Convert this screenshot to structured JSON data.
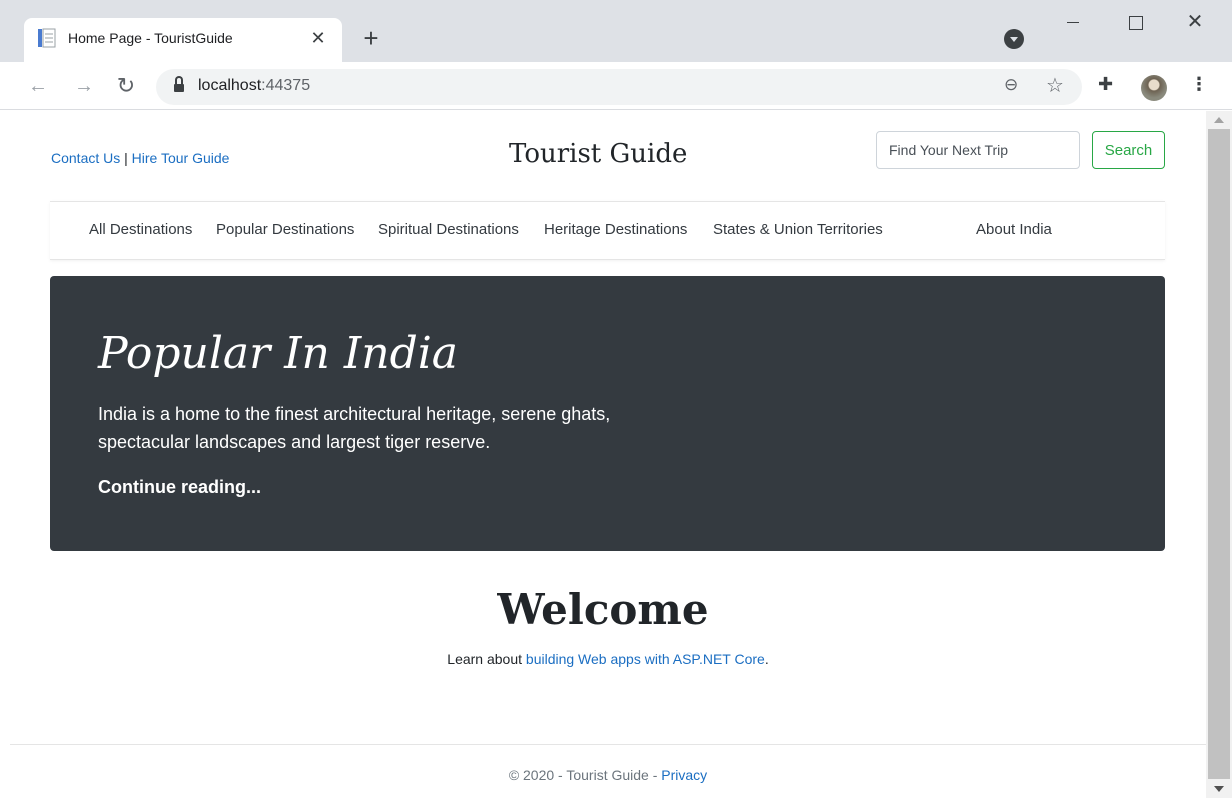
{
  "browser": {
    "tab_title": "Home Page - TouristGuide",
    "tab_close": "✕",
    "new_tab": "+",
    "url_host": "localhost",
    "url_port": ":44375",
    "window_close": "✕"
  },
  "header": {
    "contact_link": "Contact Us",
    "separator": " | ",
    "hire_link": "Hire Tour Guide",
    "site_title": "Tourist Guide",
    "search_placeholder": "Find Your Next Trip",
    "search_button": "Search"
  },
  "nav": {
    "items": [
      "All Destinations",
      "Popular Destinations",
      "Spiritual Destinations",
      "Heritage Destinations",
      "States & Union Territories",
      "About India"
    ]
  },
  "hero": {
    "title": "Popular In India",
    "lead": "India is a home to the finest architectural heritage, serene ghats, spectacular landscapes and largest tiger reserve.",
    "link": "Continue reading..."
  },
  "main": {
    "welcome": "Welcome",
    "learn_prefix": "Learn about ",
    "learn_link": "building Web apps with ASP.NET Core",
    "learn_suffix": "."
  },
  "footer": {
    "copyright": "© 2020 - Tourist Guide - ",
    "privacy_link": "Privacy"
  },
  "colors": {
    "link": "#1b6ec2",
    "jumbotron_bg": "#343a40",
    "search_button": "#28a745"
  }
}
